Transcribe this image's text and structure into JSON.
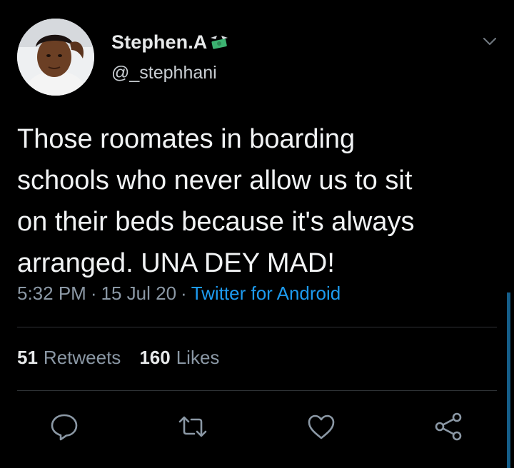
{
  "tweet": {
    "display_name": "Stephen.A",
    "name_emoji_icon": "money-with-wings-icon",
    "handle": "@_stephhani",
    "text": "Those roomates in boarding\nschools who never allow us to sit\non their beds because it's always\narranged. UNA DEY MAD!",
    "time": "5:32 PM",
    "date": "15 Jul 20",
    "separator": "·",
    "source": "Twitter for Android"
  },
  "stats": {
    "retweets_count": "51",
    "retweets_label": "Retweets",
    "likes_count": "160",
    "likes_label": "Likes"
  },
  "actions": {
    "reply_icon": "reply-icon",
    "retweet_icon": "retweet-icon",
    "like_icon": "heart-icon",
    "share_icon": "share-icon",
    "menu_icon": "chevron-down-icon"
  },
  "colors": {
    "background": "#000000",
    "text_primary": "#e7e9ea",
    "text_secondary": "#8b98a5",
    "accent": "#1d9bf0",
    "divider": "#2f3336"
  }
}
